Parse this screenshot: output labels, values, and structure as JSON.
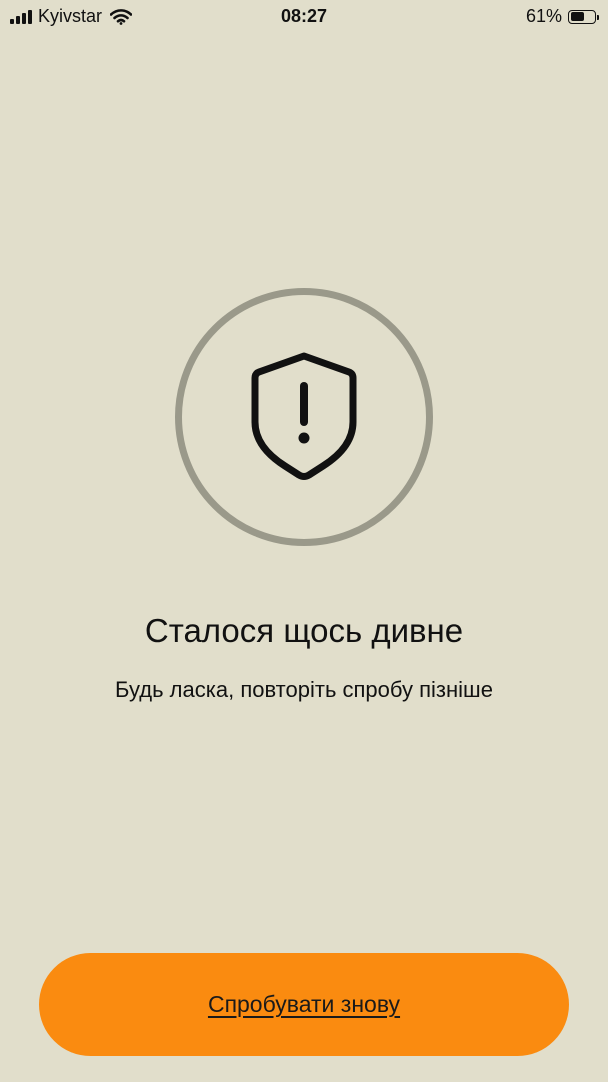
{
  "status_bar": {
    "carrier": "Kyivstar",
    "time": "08:27",
    "battery_percent_label": "61%",
    "battery_level": 0.61,
    "icons": [
      "signal-icon",
      "wifi-icon",
      "battery-icon"
    ]
  },
  "error_screen": {
    "icon": "shield-warning-icon",
    "title": "Сталося щось дивне",
    "message": "Будь ласка, повторіть спробу пізніше"
  },
  "actions": {
    "retry_label": "Спробувати знову"
  },
  "colors": {
    "background": "#e1decb",
    "ring": "#9a998a",
    "accent": "#fa8b10",
    "text": "#111111"
  }
}
